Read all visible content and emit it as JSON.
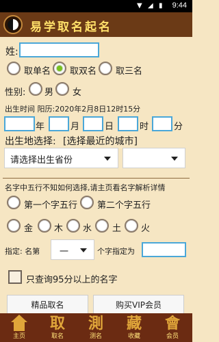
{
  "status": {
    "time": "9:44"
  },
  "header": {
    "title": "易学取名起名"
  },
  "form": {
    "surname_label": "姓:",
    "surname_value": "",
    "name_type": [
      "取单名",
      "取双名",
      "取三名"
    ],
    "name_type_selected": 1,
    "gender_label": "性别:",
    "genders": [
      "男",
      "女"
    ],
    "birth_time": "出生时间 阳历:2020年2月8日12时15分",
    "date_units": [
      "年",
      "月",
      "日",
      "时",
      "分"
    ],
    "birthplace_label": "出生地选择:",
    "recent_city": "[选择最近的城市]",
    "province_placeholder": "请选择出生省份",
    "city_placeholder": "",
    "wuxing_hint": "名字中五行不知如何选择,请主页看名字解析详情",
    "char_choice": [
      "第一个字五行",
      "第二个字五行"
    ],
    "elements": [
      "金",
      "木",
      "水",
      "土",
      "火"
    ],
    "specify_label": "指定: 名第",
    "specify_select": "一",
    "specify_suffix": "个字指定为",
    "only95_label": "只查询95分以上的名字",
    "button_premium": "精品取名",
    "button_vip": "购买VIP会员"
  },
  "tabs": [
    {
      "glyph": "",
      "label": "主页",
      "icon": "home-icon"
    },
    {
      "glyph": "取",
      "label": "取名",
      "icon": "qu-glyph-icon"
    },
    {
      "glyph": "測",
      "label": "测名",
      "icon": "ce-glyph-icon"
    },
    {
      "glyph": "藏",
      "label": "收藏",
      "icon": "cang-glyph-icon"
    },
    {
      "glyph": "會",
      "label": "会员",
      "icon": "hui-glyph-icon"
    }
  ],
  "colors": {
    "header_bg": "#6b3a16",
    "header_text": "#ffe06a",
    "page_bg": "#f6e6c3",
    "radio_checked": "#79c21f",
    "tabbar_bg": "#6b2b12"
  }
}
